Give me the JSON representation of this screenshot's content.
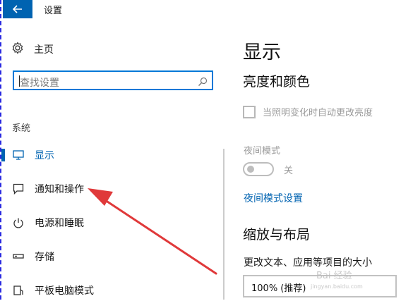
{
  "titlebar": {
    "title": "设置"
  },
  "sidebar": {
    "home_label": "主页",
    "search_placeholder": "查找设置",
    "group_label": "系统",
    "items": [
      {
        "label": "显示",
        "icon": "monitor-icon",
        "active": true
      },
      {
        "label": "通知和操作",
        "icon": "notification-icon",
        "active": false
      },
      {
        "label": "电源和睡眠",
        "icon": "power-icon",
        "active": false
      },
      {
        "label": "存储",
        "icon": "storage-icon",
        "active": false
      },
      {
        "label": "平板电脑模式",
        "icon": "tablet-icon",
        "active": false
      }
    ]
  },
  "main": {
    "title": "显示",
    "brightness_section": "亮度和颜色",
    "auto_brightness_label": "当照明变化时自动更改亮度",
    "auto_brightness_checked": false,
    "night_mode_label": "夜间模式",
    "night_mode_state": "关",
    "night_mode_settings_link": "夜间模式设置",
    "scale_section": "缩放与布局",
    "text_size_label": "更改文本、应用等项目的大小",
    "text_size_value": "100% (推荐)"
  },
  "watermark": {
    "text": "Bai 经验",
    "sub": "jingyan.baidu.com"
  },
  "colors": {
    "accent": "#0063b1",
    "annotation_arrow": "#e0393a"
  }
}
